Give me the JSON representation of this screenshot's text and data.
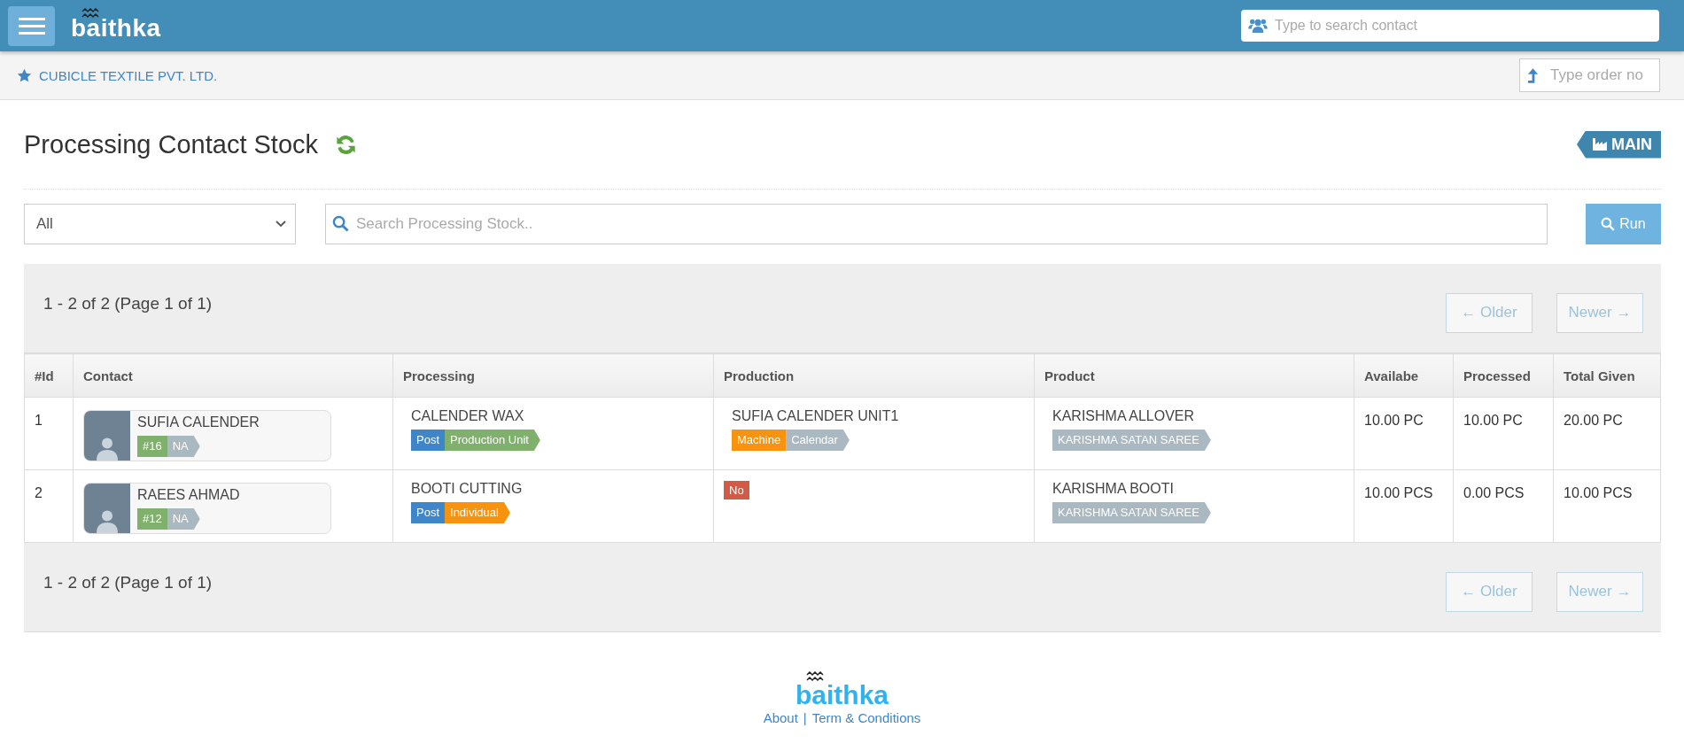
{
  "header": {
    "logo": "baithka",
    "search_placeholder": "Type to search contact"
  },
  "subheader": {
    "company": "CUBICLE TEXTILE PVT. LTD.",
    "order_placeholder": "Type order no"
  },
  "page": {
    "title": "Processing Contact Stock",
    "badge": "MAIN"
  },
  "filters": {
    "select_value": "All",
    "search_placeholder": "Search Processing Stock..",
    "run_button": "Run"
  },
  "pagination_top": {
    "summary": "1 - 2 of 2 (Page 1 of 1)",
    "older": {
      "label": "← Older",
      "disabled": true
    },
    "newer": {
      "label": "Newer →",
      "disabled": true
    }
  },
  "table": {
    "columns": [
      "#Id",
      "Contact",
      "Processing",
      "Production",
      "Product",
      "Availabe",
      "Processed",
      "Total Given"
    ],
    "rows": [
      {
        "id": "1",
        "contact": {
          "name": "SUFIA CALENDER",
          "tags": [
            {
              "label": "#16",
              "color": "#7fb06c"
            },
            {
              "label": "NA",
              "color": "#aab8c2"
            }
          ]
        },
        "processing": {
          "name": "CALENDER WAX",
          "tags": [
            {
              "label": "Post",
              "color": "#3f86c8"
            },
            {
              "label": "Production Unit",
              "color": "#7fb06c"
            }
          ]
        },
        "production": {
          "name": "SUFIA CALENDER UNIT1",
          "tags": [
            {
              "label": "Machine",
              "color": "#f7930f"
            },
            {
              "label": "Calendar",
              "color": "#aab8c2"
            }
          ]
        },
        "product": {
          "name": "KARISHMA ALLOVER",
          "tags": [
            {
              "label": "KARISHMA SATAN SAREE",
              "color": "#aab8c2"
            }
          ]
        },
        "available": "10.00 PC",
        "processed": "10.00 PC",
        "total": "20.00 PC"
      },
      {
        "id": "2",
        "contact": {
          "name": "RAEES AHMAD",
          "tags": [
            {
              "label": "#12",
              "color": "#7fb06c"
            },
            {
              "label": "NA",
              "color": "#aab8c2"
            }
          ]
        },
        "processing": {
          "name": "BOOTI CUTTING",
          "tags": [
            {
              "label": "Post",
              "color": "#3f86c8"
            },
            {
              "label": "Individual",
              "color": "#f7930f"
            }
          ]
        },
        "production": {
          "flag": "No"
        },
        "product": {
          "name": "KARISHMA BOOTI",
          "tags": [
            {
              "label": "KARISHMA SATAN SAREE",
              "color": "#aab8c2"
            }
          ]
        },
        "available": "10.00 PCS",
        "processed": "0.00 PCS",
        "total": "10.00 PCS"
      }
    ]
  },
  "pagination_bottom": {
    "summary": "1 - 2 of 2 (Page 1 of 1)",
    "older": {
      "label": "← Older",
      "disabled": true
    },
    "newer": {
      "label": "Newer →",
      "disabled": true
    }
  },
  "footer": {
    "logo": "baithka",
    "links": [
      "About",
      "Term & Conditions"
    ],
    "separator": "|"
  }
}
